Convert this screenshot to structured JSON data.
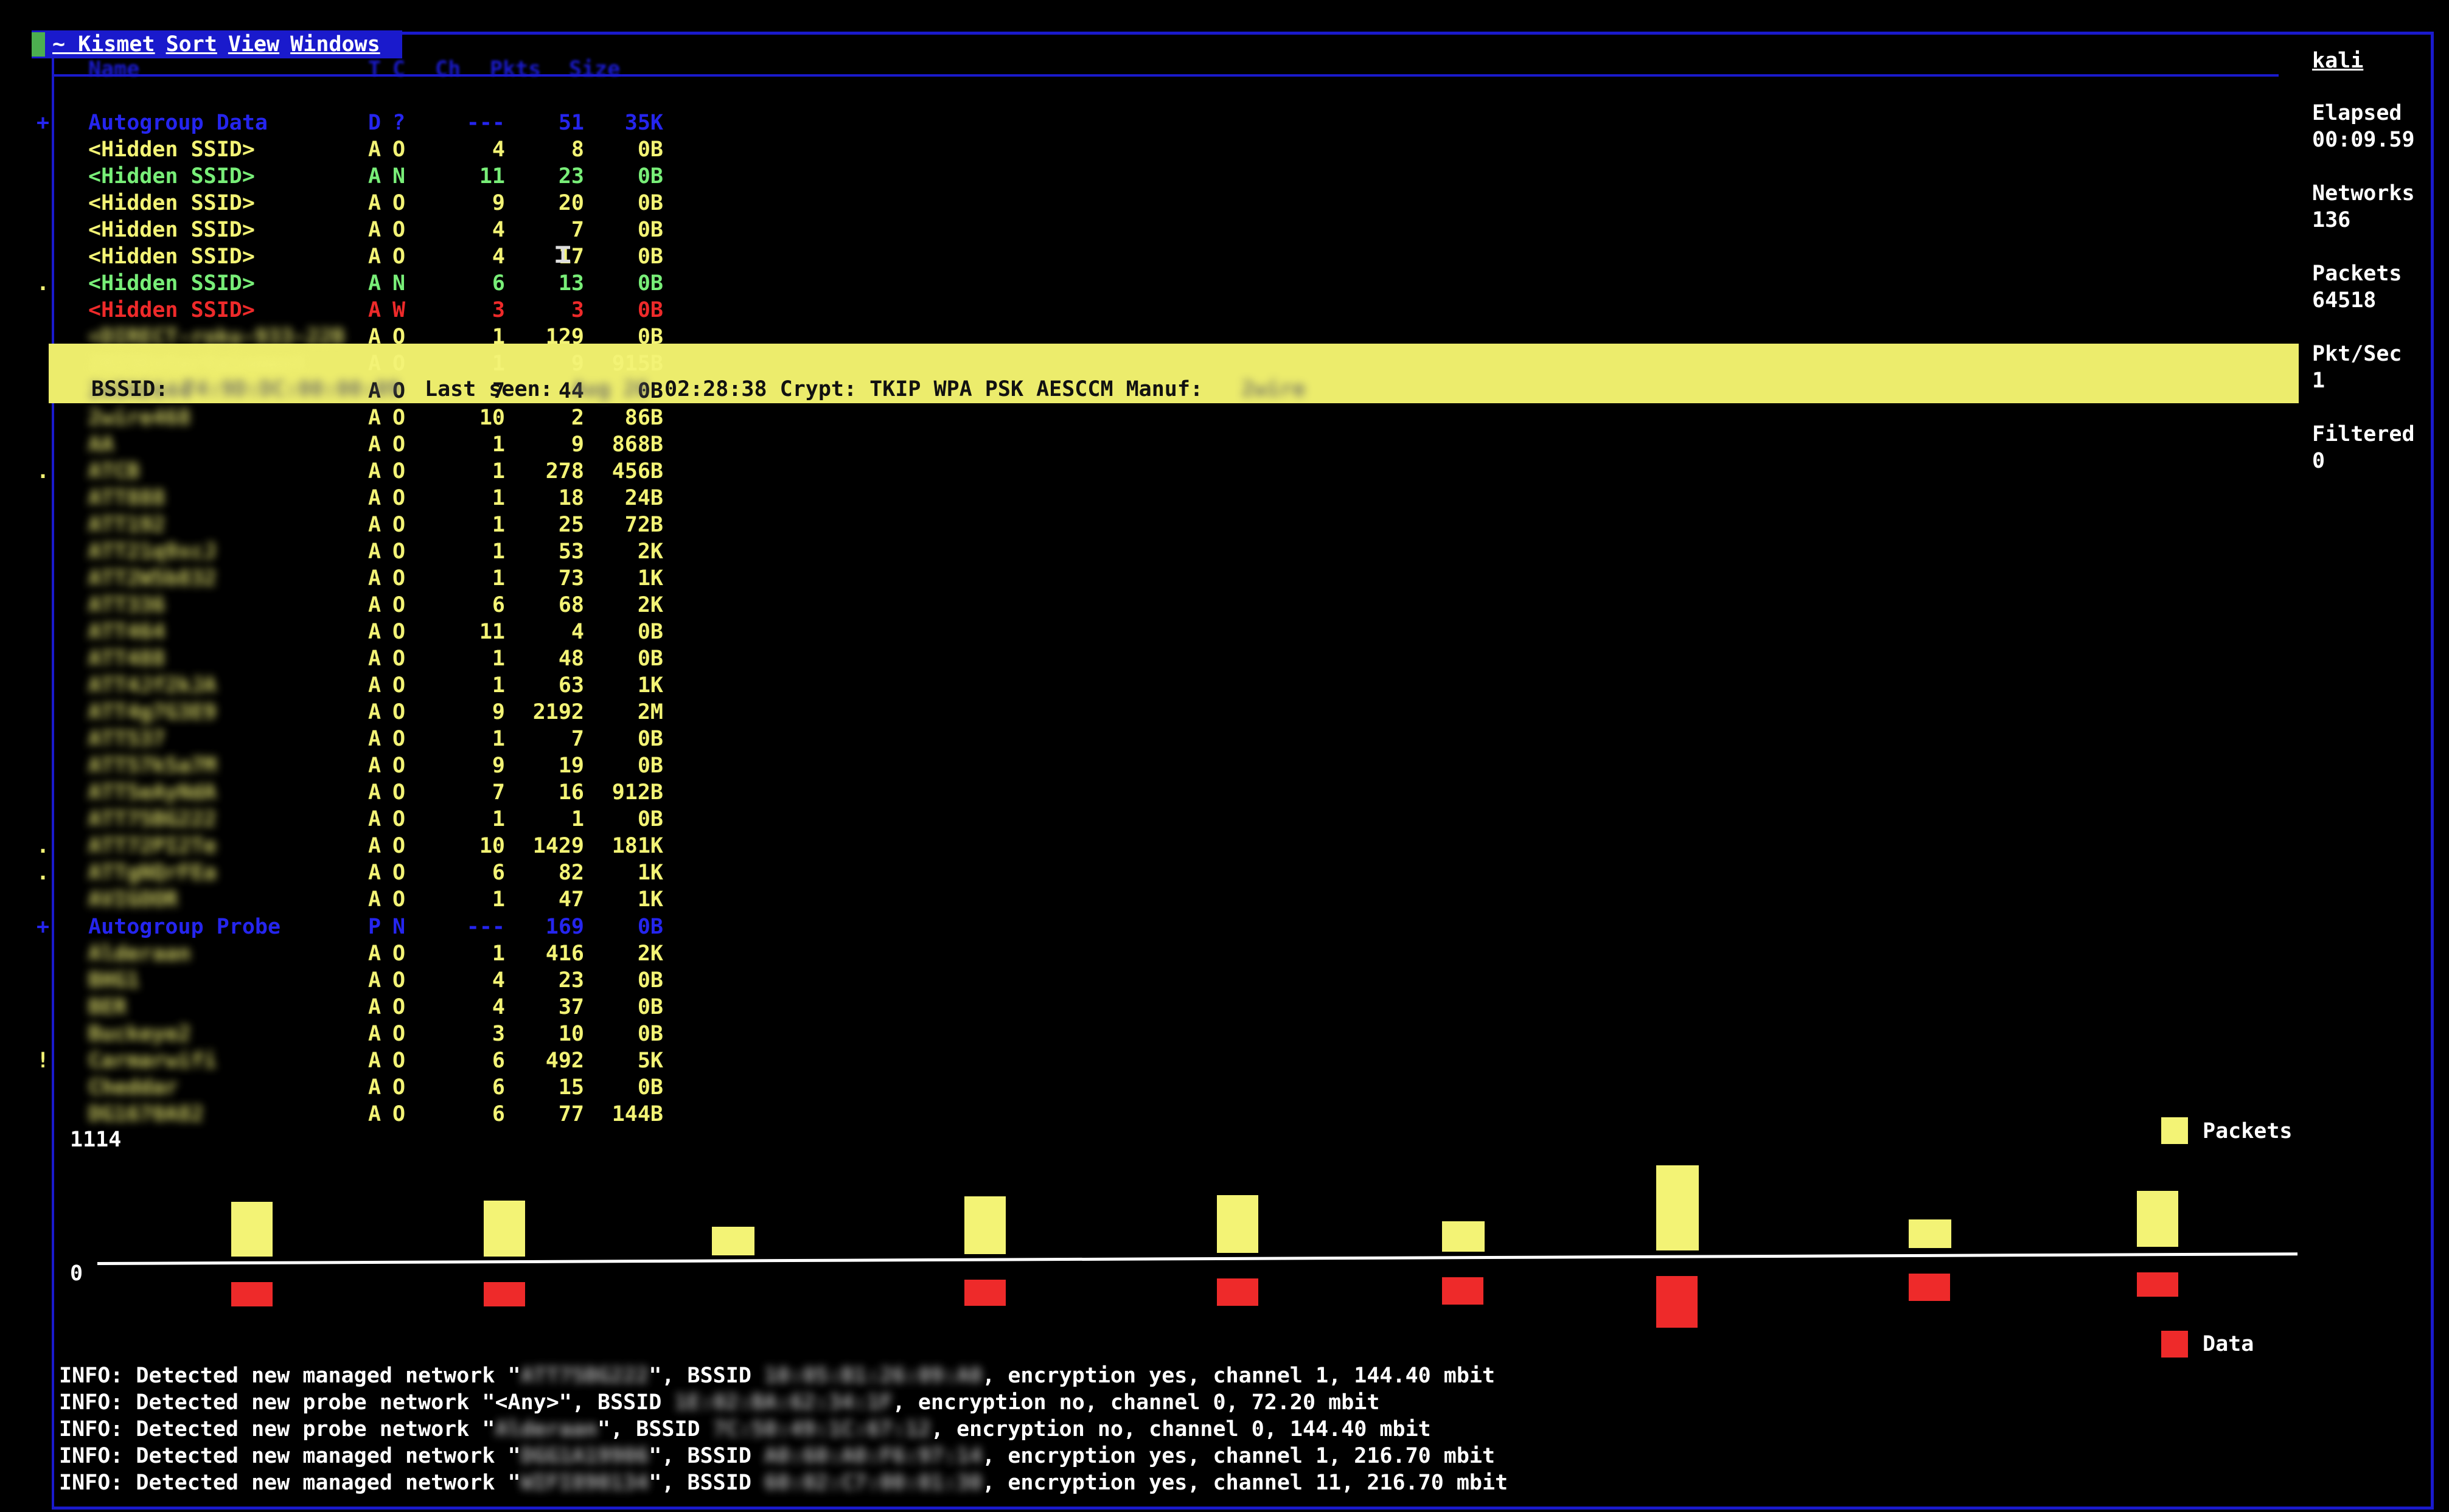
{
  "menu": {
    "app": "~ Kismet",
    "items": [
      "Sort",
      "View",
      "Windows"
    ]
  },
  "columns": [
    "Name",
    "T",
    "C",
    "Ch",
    "Pkts",
    "Size"
  ],
  "networks": [
    {
      "mark": "+",
      "name": "Autogroup Data",
      "t": "D",
      "c": "?",
      "ch": "---",
      "pkts": "51",
      "size": "35K",
      "color": "blue"
    },
    {
      "mark": "",
      "name": "<Hidden SSID>",
      "t": "A",
      "c": "O",
      "ch": "4",
      "pkts": "8",
      "size": "0B",
      "color": "yellow"
    },
    {
      "mark": "",
      "name": "<Hidden SSID>",
      "t": "A",
      "c": "N",
      "ch": "11",
      "pkts": "23",
      "size": "0B",
      "color": "green"
    },
    {
      "mark": "",
      "name": "<Hidden SSID>",
      "t": "A",
      "c": "O",
      "ch": "9",
      "pkts": "20",
      "size": "0B",
      "color": "yellow"
    },
    {
      "mark": "",
      "name": "<Hidden SSID>",
      "t": "A",
      "c": "O",
      "ch": "4",
      "pkts": "7",
      "size": "0B",
      "color": "yellow"
    },
    {
      "mark": "",
      "name": "<Hidden SSID>",
      "t": "A",
      "c": "O",
      "ch": "4",
      "pkts": "17",
      "size": "0B",
      "color": "yellow"
    },
    {
      "mark": ".",
      "name": "<Hidden SSID>",
      "t": "A",
      "c": "N",
      "ch": "6",
      "pkts": "13",
      "size": "0B",
      "color": "green"
    },
    {
      "mark": "",
      "name": "<Hidden SSID>",
      "t": "A",
      "c": "W",
      "ch": "3",
      "pkts": "3",
      "size": "0B",
      "color": "red"
    },
    {
      "mark": "",
      "name": "<DIRECT-roku-933-22B",
      "t": "A",
      "c": "O",
      "ch": "1",
      "pkts": "129",
      "size": "0B",
      "color": "yellow",
      "blur": true
    },
    {
      "mark": "",
      "name": "2023Entertainment",
      "t": "A",
      "c": "O",
      "ch": "1",
      "pkts": "9",
      "size": "915B",
      "color": "yellow",
      "blur": true
    },
    {
      "mark": "",
      "name": "2WIRE644",
      "t": "A",
      "c": "O",
      "ch": "7",
      "pkts": "44",
      "size": "0B",
      "color": "selected",
      "blur": true
    },
    {
      "mark": "",
      "name": "2wire468",
      "t": "A",
      "c": "O",
      "ch": "10",
      "pkts": "2",
      "size": "86B",
      "color": "yellow",
      "blur": true
    },
    {
      "mark": "",
      "name": "AA",
      "t": "A",
      "c": "O",
      "ch": "1",
      "pkts": "9",
      "size": "868B",
      "color": "yellow",
      "blur": true
    },
    {
      "mark": ".",
      "name": "ATCB",
      "t": "A",
      "c": "O",
      "ch": "1",
      "pkts": "278",
      "size": "456B",
      "color": "yellow",
      "blur": true
    },
    {
      "mark": "",
      "name": "ATT888",
      "t": "A",
      "c": "O",
      "ch": "1",
      "pkts": "18",
      "size": "24B",
      "color": "yellow",
      "blur": true
    },
    {
      "mark": "",
      "name": "ATT192",
      "t": "A",
      "c": "O",
      "ch": "1",
      "pkts": "25",
      "size": "72B",
      "color": "yellow",
      "blur": true
    },
    {
      "mark": "",
      "name": "ATT21q9xcJ",
      "t": "A",
      "c": "O",
      "ch": "1",
      "pkts": "53",
      "size": "2K",
      "color": "yellow",
      "blur": true
    },
    {
      "mark": "",
      "name": "ATT2W5b832",
      "t": "A",
      "c": "O",
      "ch": "1",
      "pkts": "73",
      "size": "1K",
      "color": "yellow",
      "blur": true
    },
    {
      "mark": "",
      "name": "ATT336",
      "t": "A",
      "c": "O",
      "ch": "6",
      "pkts": "68",
      "size": "2K",
      "color": "yellow",
      "blur": true
    },
    {
      "mark": "",
      "name": "ATT464",
      "t": "A",
      "c": "O",
      "ch": "11",
      "pkts": "4",
      "size": "0B",
      "color": "yellow",
      "blur": true
    },
    {
      "mark": "",
      "name": "ATT488",
      "t": "A",
      "c": "O",
      "ch": "1",
      "pkts": "48",
      "size": "0B",
      "color": "yellow",
      "blur": true
    },
    {
      "mark": "",
      "name": "ATT4Jf2kJA",
      "t": "A",
      "c": "O",
      "ch": "1",
      "pkts": "63",
      "size": "1K",
      "color": "yellow",
      "blur": true
    },
    {
      "mark": "",
      "name": "ATT4g7G3E9",
      "t": "A",
      "c": "O",
      "ch": "9",
      "pkts": "2192",
      "size": "2M",
      "color": "yellow",
      "blur": true
    },
    {
      "mark": "",
      "name": "ATT537",
      "t": "A",
      "c": "O",
      "ch": "1",
      "pkts": "7",
      "size": "0B",
      "color": "yellow",
      "blur": true
    },
    {
      "mark": "",
      "name": "ATT57k5a7M",
      "t": "A",
      "c": "O",
      "ch": "9",
      "pkts": "19",
      "size": "0B",
      "color": "yellow",
      "blur": true
    },
    {
      "mark": "",
      "name": "ATT5eAyNdA",
      "t": "A",
      "c": "O",
      "ch": "7",
      "pkts": "16",
      "size": "912B",
      "color": "yellow",
      "blur": true
    },
    {
      "mark": "",
      "name": "ATT75BG222",
      "t": "A",
      "c": "O",
      "ch": "1",
      "pkts": "1",
      "size": "0B",
      "color": "yellow",
      "blur": true
    },
    {
      "mark": ".",
      "name": "ATT72PI2Te",
      "t": "A",
      "c": "O",
      "ch": "10",
      "pkts": "1429",
      "size": "181K",
      "color": "yellow",
      "blur": true
    },
    {
      "mark": ".",
      "name": "ATTgNQrFEa",
      "t": "A",
      "c": "O",
      "ch": "6",
      "pkts": "82",
      "size": "1K",
      "color": "yellow",
      "blur": true
    },
    {
      "mark": "",
      "name": "AVIGOOR",
      "t": "A",
      "c": "O",
      "ch": "1",
      "pkts": "47",
      "size": "1K",
      "color": "yellow",
      "blur": true
    },
    {
      "mark": "+",
      "name": "Autogroup Probe",
      "t": "P",
      "c": "N",
      "ch": "---",
      "pkts": "169",
      "size": "0B",
      "color": "blue"
    },
    {
      "mark": "",
      "name": "Alderaan",
      "t": "A",
      "c": "O",
      "ch": "1",
      "pkts": "416",
      "size": "2K",
      "color": "yellow",
      "blur": true
    },
    {
      "mark": "",
      "name": "BHG1",
      "t": "A",
      "c": "O",
      "ch": "4",
      "pkts": "23",
      "size": "0B",
      "color": "yellow",
      "blur": true
    },
    {
      "mark": "",
      "name": "BER",
      "t": "A",
      "c": "O",
      "ch": "4",
      "pkts": "37",
      "size": "0B",
      "color": "yellow",
      "blur": true
    },
    {
      "mark": "",
      "name": "Buckeye2",
      "t": "A",
      "c": "O",
      "ch": "3",
      "pkts": "10",
      "size": "0B",
      "color": "yellow",
      "blur": true
    },
    {
      "mark": "!",
      "name": "Carmarwifi",
      "t": "A",
      "c": "O",
      "ch": "6",
      "pkts": "492",
      "size": "5K",
      "color": "yellow",
      "blur": true
    },
    {
      "mark": "",
      "name": "Cheddar",
      "t": "A",
      "c": "O",
      "ch": "6",
      "pkts": "15",
      "size": "0B",
      "color": "yellow",
      "blur": true
    },
    {
      "mark": "",
      "name": "DG1670A82",
      "t": "A",
      "c": "O",
      "ch": "6",
      "pkts": "77",
      "size": "144B",
      "color": "yellow",
      "blur": true
    }
  ],
  "selected_detail": {
    "bssid_label": "BSSID:",
    "bssid": "74:9D:DC:00:00:09",
    "last_seen_label": "Last seen:",
    "last_seen_date": "Aug 26",
    "rest": "02:28:38 Crypt: TKIP WPA PSK AESCCM Manuf:",
    "manuf": "2wire"
  },
  "sidebar": [
    {
      "label": "kali",
      "value": ""
    },
    {
      "label": "Elapsed",
      "value": "00:09.59"
    },
    {
      "label": "Networks",
      "value": "136"
    },
    {
      "label": "Packets",
      "value": "64518"
    },
    {
      "label": "Pkt/Sec",
      "value": "1"
    },
    {
      "label": "Filtered",
      "value": "0"
    }
  ],
  "graph": {
    "max_label": "1114",
    "zero_label": "0",
    "legend_packets": "Packets",
    "legend_data": "Data",
    "colors": {
      "packets": "#f3f375",
      "data": "#ee2a2a"
    },
    "packets": [
      90,
      92,
      47,
      95,
      95,
      50,
      140,
      47,
      92
    ],
    "data": [
      40,
      40,
      0,
      43,
      45,
      45,
      85,
      45,
      40
    ]
  },
  "info_lines": [
    {
      "prefix": "INFO: Detected new managed network \"",
      "ssid": "ATT75BG222",
      "mid": "\", BSSID ",
      "bssid": "10:05:B1:26:09:A0",
      "suffix": ", encryption yes, channel 1, 144.40 mbit"
    },
    {
      "prefix": "INFO: Detected new probe network \"<Any>\", BSSID ",
      "ssid": "",
      "mid": "",
      "bssid": "1E:02:BA:62:34:1F",
      "suffix": ", encryption no, channel 0, 72.20 mbit"
    },
    {
      "prefix": "INFO: Detected new probe network \"",
      "ssid": "Alderaan",
      "mid": "\", BSSID ",
      "bssid": "7C:50:49:1C:67:12",
      "suffix": ", encryption no, channel 0, 144.40 mbit"
    },
    {
      "prefix": "INFO: Detected new managed network \"",
      "ssid": "DGG1A19906",
      "mid": "\", BSSID ",
      "bssid": "A0:60:A0:F6:97:14",
      "suffix": ", encryption yes, channel 1, 216.70 mbit"
    },
    {
      "prefix": "INFO: Detected new managed network \"",
      "ssid": "WIFI890134",
      "mid": "\", BSSID ",
      "bssid": "60:02:C7:00:01:30",
      "suffix": ", encryption yes, channel 11, 216.70 mbit"
    }
  ]
}
